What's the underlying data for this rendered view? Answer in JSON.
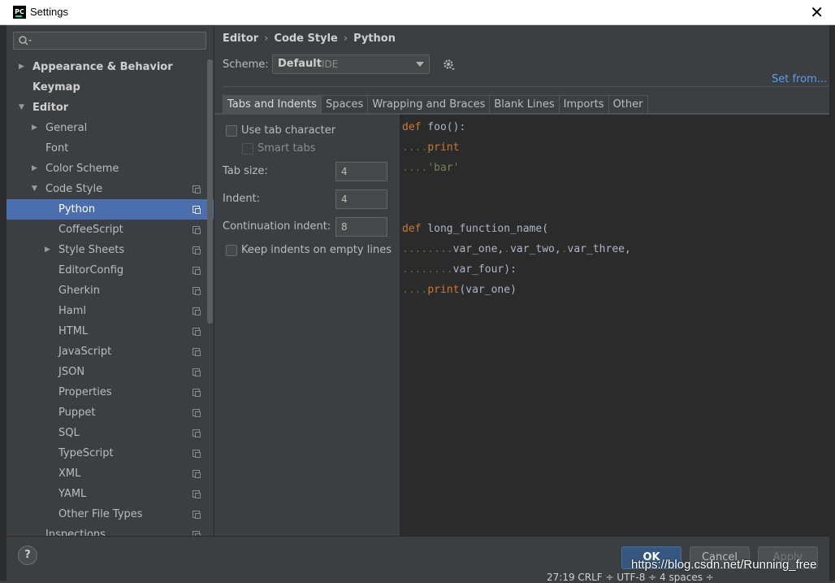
{
  "window": {
    "title": "Settings",
    "app_logo": "PC"
  },
  "sidebar": {
    "search_placeholder": "",
    "items": [
      {
        "label": "Appearance & Behavior"
      },
      {
        "label": "Keymap"
      },
      {
        "label": "Editor"
      },
      {
        "label": "General"
      },
      {
        "label": "Font"
      },
      {
        "label": "Color Scheme"
      },
      {
        "label": "Code Style"
      },
      {
        "label": "Python"
      },
      {
        "label": "CoffeeScript"
      },
      {
        "label": "Style Sheets"
      },
      {
        "label": "EditorConfig"
      },
      {
        "label": "Gherkin"
      },
      {
        "label": "Haml"
      },
      {
        "label": "HTML"
      },
      {
        "label": "JavaScript"
      },
      {
        "label": "JSON"
      },
      {
        "label": "Properties"
      },
      {
        "label": "Puppet"
      },
      {
        "label": "SQL"
      },
      {
        "label": "TypeScript"
      },
      {
        "label": "XML"
      },
      {
        "label": "YAML"
      },
      {
        "label": "Other File Types"
      },
      {
        "label": "Inspections"
      }
    ],
    "selected": "Python"
  },
  "breadcrumb": [
    "Editor",
    "Code Style",
    "Python"
  ],
  "scheme": {
    "label": "Scheme:",
    "value": "Default",
    "sub": "IDE",
    "set_from": "Set from..."
  },
  "tabs": [
    "Tabs and Indents",
    "Spaces",
    "Wrapping and Braces",
    "Blank Lines",
    "Imports",
    "Other"
  ],
  "active_tab": "Tabs and Indents",
  "options": {
    "use_tab": {
      "label": "Use tab character",
      "checked": false
    },
    "smart_tabs": {
      "label": "Smart tabs",
      "checked": false,
      "disabled": true
    },
    "tab_size": {
      "label": "Tab size:",
      "value": "4"
    },
    "indent": {
      "label": "Indent:",
      "value": "4"
    },
    "continuation": {
      "label": "Continuation indent:",
      "value": "8"
    },
    "keep_indents": {
      "label": "Keep indents on empty lines",
      "checked": false
    }
  },
  "preview": {
    "l1_kw": "def",
    "l1_rest": " foo():",
    "l2_ws": "....",
    "l2_kw": "print",
    "l3_ws": "....",
    "l3_str": "'bar'",
    "l4_kw": "def",
    "l4_rest": " long_function_name(",
    "l5_ws": "........",
    "l5_a": "var_one,",
    "l5_ws2": ".",
    "l5_b": "var_two,",
    "l5_ws3": ".",
    "l5_c": "var_three,",
    "l6_ws": "........",
    "l6_a": "var_four):",
    "l7_ws": "....",
    "l7_kw": "print",
    "l7_rest": "(var_one)"
  },
  "buttons": {
    "help": "?",
    "ok": "OK",
    "cancel": "Cancel",
    "apply": "Apply"
  },
  "overlay": {
    "watermark": "https://blog.csdn.net/Running_free",
    "status": "27:19   CRLF ÷   UTF-8 ÷   4 spaces ÷"
  },
  "colors": {
    "selection": "#4b6eaf",
    "link": "#589df6",
    "keyword": "#cc7832",
    "string": "#6a8759"
  },
  "icons": [
    "search-icon",
    "gear-icon",
    "close-icon",
    "copy-scheme-icon",
    "chevron-right-icon",
    "chevron-down-icon",
    "dropdown-arrow-icon",
    "help-icon"
  ]
}
